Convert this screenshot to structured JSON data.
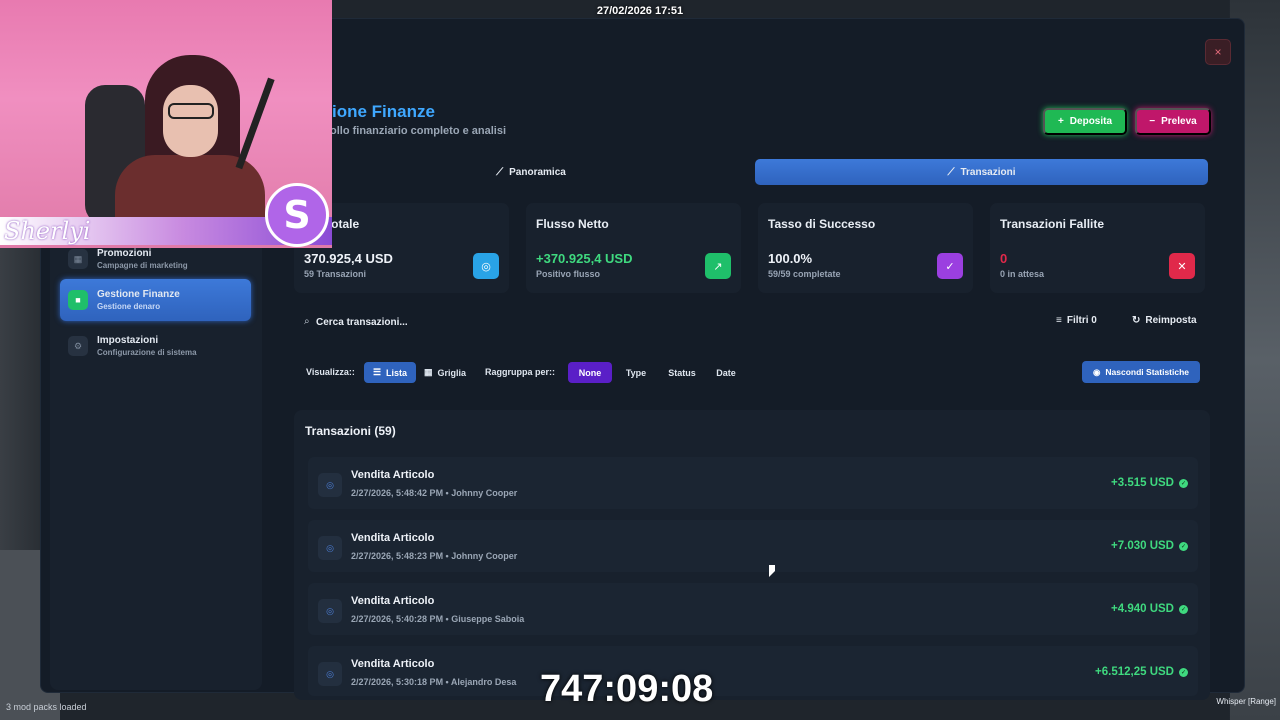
{
  "datetime": "27/02/2026 17:51",
  "app": {
    "title": "ione Finanze",
    "subtitle": "ollo finanziario completo e analisi",
    "close_label": "×"
  },
  "sidebar": {
    "items": [
      {
        "label": "Promozioni",
        "sub": "Campagne di marketing",
        "icon": "grid-icon"
      },
      {
        "label": "Gestione Finanze",
        "sub": "Gestione denaro",
        "icon": "wallet-icon",
        "active": true
      },
      {
        "label": "Impostazioni",
        "sub": "Configurazione di sistema",
        "icon": "gear-icon"
      }
    ]
  },
  "header": {
    "deposit_label": "Deposita",
    "withdraw_label": "Preleva"
  },
  "tabs": {
    "overview": "Panoramica",
    "transactions": "Transazioni"
  },
  "stats": [
    {
      "title": "me Totale",
      "value": "370.925,4 USD",
      "sub": "59 Transazioni",
      "color": "#29a3e6"
    },
    {
      "title": "Flusso Netto",
      "value": "+370.925,4 USD",
      "sub": "Positivo flusso",
      "color": "#1fbf6a"
    },
    {
      "title": "Tasso di Successo",
      "value": "100.0%",
      "sub": "59/59 completate",
      "color": "#9b3fe0"
    },
    {
      "title": "Transazioni Fallite",
      "value": "0",
      "sub": "0 in attesa",
      "color": "#e0294a"
    }
  ],
  "search": {
    "placeholder": "Cerca transazioni...",
    "filters_label": "Filtri 0",
    "reset_label": "Reimposta"
  },
  "view": {
    "label": "Visualizza::",
    "list": "Lista",
    "grid": "Griglia",
    "group_label": "Raggruppa per::",
    "group_none": "None",
    "group_type": "Type",
    "group_status": "Status",
    "group_date": "Date",
    "hide_stats": "Nascondi Statistiche"
  },
  "transactions": {
    "title": "Transazioni (59)",
    "rows": [
      {
        "name": "Vendita Articolo",
        "detail": "2/27/2026, 5:48:42 PM • Johnny Cooper",
        "amount": "+3.515 USD"
      },
      {
        "name": "Vendita Articolo",
        "detail": "2/27/2026, 5:48:23 PM • Johnny Cooper",
        "amount": "+7.030 USD"
      },
      {
        "name": "Vendita Articolo",
        "detail": "2/27/2026, 5:40:28 PM • Giuseppe Saboia",
        "amount": "+4.940 USD"
      },
      {
        "name": "Vendita Articolo",
        "detail": "2/27/2026, 5:30:18 PM • Alejandro Desa",
        "amount": "+6.512,25 USD"
      }
    ]
  },
  "overlay": {
    "streamer_name": "Sherlyi",
    "logo_letter": "S",
    "timer": "747:09:08",
    "bottom_left": "3 mod packs loaded",
    "bottom_right_1": "Whisper [Range]"
  }
}
